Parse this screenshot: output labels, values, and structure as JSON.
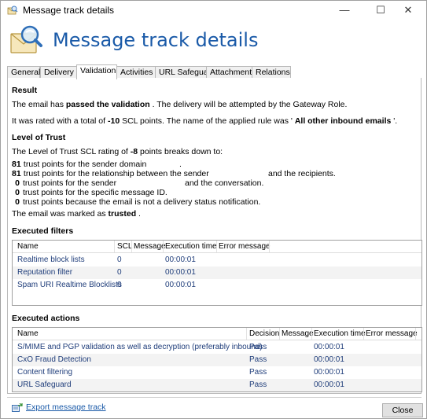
{
  "window": {
    "title": "Message track details",
    "minimize_glyph": "—",
    "maximize_glyph": "☐",
    "close_glyph": "✕"
  },
  "header": {
    "heading": "Message track details"
  },
  "tabs": [
    {
      "label": "General"
    },
    {
      "label": "Delivery"
    },
    {
      "label": "Validation",
      "active": true
    },
    {
      "label": "Activities"
    },
    {
      "label": "URL Safeguard"
    },
    {
      "label": "Attachments"
    },
    {
      "label": "Relations"
    }
  ],
  "result": {
    "heading": "Result",
    "line1_pre": "The email has ",
    "line1_bold": "passed the validation",
    "line1_post": " . The delivery will be attempted by the Gateway Role.",
    "line2_pre": "It was rated with a total of ",
    "line2_bold": "-10",
    "line2_mid": " SCL points.  The name of the applied rule was ' ",
    "line2_rule": "All other inbound emails",
    "line2_post": " '."
  },
  "trust": {
    "heading": "Level of Trust",
    "intro_pre": "The Level of Trust SCL rating of ",
    "intro_bold": "-8",
    "intro_post": " points breaks down to:",
    "items": [
      {
        "num": "81",
        "text": "trust points for the sender domain",
        "suffix": "."
      },
      {
        "num": "81",
        "text": "trust points for the relationship between the sender",
        "suffix": "and the recipients."
      },
      {
        "num": "0",
        "text": "trust points for the sender",
        "suffix": "and the conversation."
      },
      {
        "num": "0",
        "text": "trust points for the specific message ID.",
        "suffix": ""
      },
      {
        "num": "0",
        "text": "trust points because the email is not a delivery status notification.",
        "suffix": ""
      }
    ],
    "marked_pre": "The email was marked as ",
    "marked_bold": "trusted",
    "marked_post": " ."
  },
  "filters": {
    "heading": "Executed filters",
    "columns": [
      "Name",
      "SCL",
      "Message",
      "Execution time",
      "Error message"
    ],
    "rows": [
      {
        "name": "Realtime block lists",
        "scl": "0",
        "message": "",
        "time": "00:00:01",
        "error": ""
      },
      {
        "name": "Reputation filter",
        "scl": "0",
        "message": "",
        "time": "00:00:01",
        "error": ""
      },
      {
        "name": "Spam URI Realtime Blocklists",
        "scl": "0",
        "message": "",
        "time": "00:00:01",
        "error": ""
      }
    ]
  },
  "actions": {
    "heading": "Executed actions",
    "columns": [
      "Name",
      "Decision",
      "Message",
      "Execution time",
      "Error message"
    ],
    "rows": [
      {
        "name": "S/MIME and PGP validation as well as decryption (preferably inbound)",
        "decision": "Pass",
        "message": "",
        "time": "00:00:01",
        "error": ""
      },
      {
        "name": "CxO Fraud Detection",
        "decision": "Pass",
        "message": "",
        "time": "00:00:01",
        "error": ""
      },
      {
        "name": "Content filtering",
        "decision": "Pass",
        "message": "",
        "time": "00:00:01",
        "error": ""
      },
      {
        "name": "URL Safeguard",
        "decision": "Pass",
        "message": "",
        "time": "00:00:01",
        "error": ""
      }
    ]
  },
  "footer": {
    "export_label": "Export message track",
    "close_label": "Close"
  },
  "colors": {
    "accent": "#1a5aa8",
    "link": "#1f3d7a",
    "alt_row": "#f3f3f3"
  }
}
